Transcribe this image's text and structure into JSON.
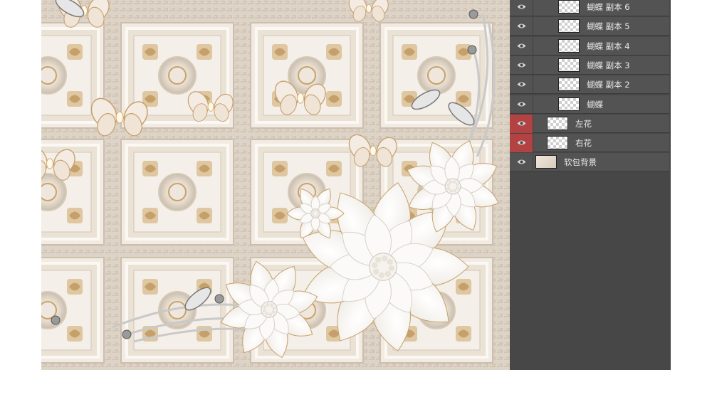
{
  "canvas": {
    "description_icon": "image-canvas",
    "colors": {
      "panel_bg": "#e8ddd2",
      "flower": "#f7f5f2",
      "gold": "#c9a36a",
      "selected_eye": "#b34242"
    }
  },
  "layers_panel": {
    "layers": [
      {
        "name": "蝴蝶 副本 6",
        "visible": true,
        "selected": false,
        "thumb": "transparent"
      },
      {
        "name": "蝴蝶 副本 5",
        "visible": true,
        "selected": false,
        "thumb": "transparent"
      },
      {
        "name": "蝴蝶 副本 4",
        "visible": true,
        "selected": false,
        "thumb": "transparent"
      },
      {
        "name": "蝴蝶 副本 3",
        "visible": true,
        "selected": false,
        "thumb": "transparent"
      },
      {
        "name": "蝴蝶 副本 2",
        "visible": true,
        "selected": false,
        "thumb": "transparent"
      },
      {
        "name": "蝴蝶",
        "visible": true,
        "selected": false,
        "thumb": "transparent"
      },
      {
        "name": "左花",
        "visible": true,
        "selected": true,
        "thumb": "transparent"
      },
      {
        "name": "右花",
        "visible": true,
        "selected": true,
        "thumb": "transparent"
      },
      {
        "name": "软包背景",
        "visible": true,
        "selected": false,
        "thumb": "background"
      }
    ]
  }
}
